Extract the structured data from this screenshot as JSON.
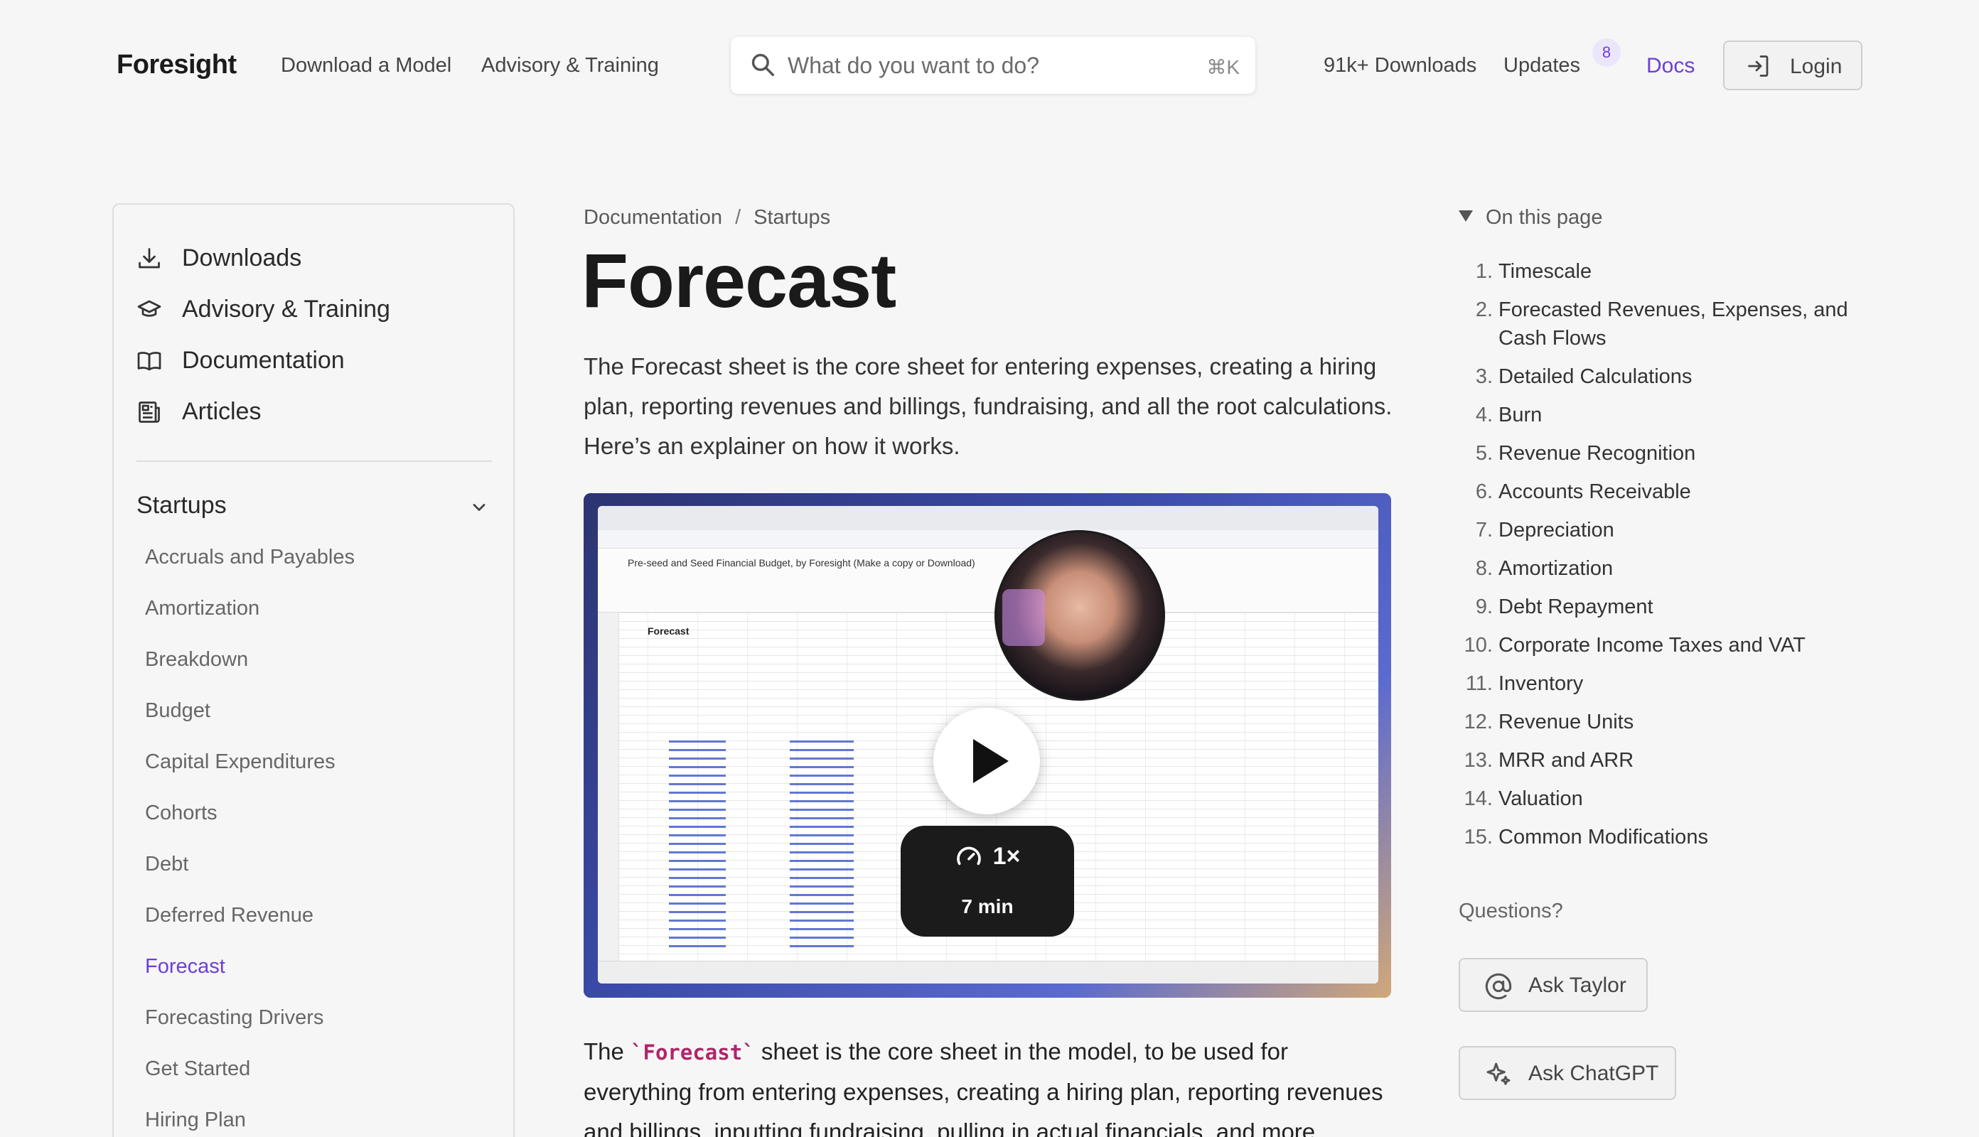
{
  "header": {
    "brand": "Foresight",
    "nav": [
      "Download a Model",
      "Advisory & Training"
    ],
    "search_placeholder": "What do you want to do?",
    "search_shortcut": "⌘K",
    "downloads": "91k+ Downloads",
    "updates": "Updates",
    "updates_badge": "8",
    "docs": "Docs",
    "login": "Login",
    "accent_color": "#6d3fd6"
  },
  "sidebar": {
    "main_items": [
      {
        "label": "Downloads",
        "icon": "download-icon"
      },
      {
        "label": "Advisory & Training",
        "icon": "graduation-cap-icon"
      },
      {
        "label": "Documentation",
        "icon": "book-icon"
      },
      {
        "label": "Articles",
        "icon": "newspaper-icon"
      }
    ],
    "section": "Startups",
    "sub_items": [
      "Accruals and Payables",
      "Amortization",
      "Breakdown",
      "Budget",
      "Capital Expenditures",
      "Cohorts",
      "Debt",
      "Deferred Revenue",
      "Forecast",
      "Forecasting Drivers",
      "Get Started",
      "Hiring Plan"
    ],
    "active_item": "Forecast"
  },
  "main": {
    "breadcrumb": [
      "Documentation",
      "Startups"
    ],
    "breadcrumb_sep": "/",
    "title": "Forecast",
    "intro": "The Forecast sheet is the core sheet for entering expenses, creating a hiring plan, reporting revenues and billings, fundraising, and all the root calculations. Here’s an explainer on how it works.",
    "video": {
      "doc_title": "Pre-seed and Seed Financial Budget, by Foresight (Make a copy or Download)",
      "sheet_title": "Forecast",
      "speed": "1×",
      "duration": "7 min"
    },
    "body_prefix": "The ",
    "body_code": "`Forecast`",
    "body_suffix": " sheet is the core sheet in the model, to be used for everything from entering expenses, creating a hiring plan, reporting revenues and billings, inputting fundraising, pulling in actual financials, and more."
  },
  "toc": {
    "heading": "On this page",
    "items": [
      {
        "num": "1.",
        "label": "Timescale"
      },
      {
        "num": "2.",
        "label": "Forecasted Revenues, Expenses, and Cash Flows"
      },
      {
        "num": "3.",
        "label": "Detailed Calculations"
      },
      {
        "num": "4.",
        "label": "Burn"
      },
      {
        "num": "5.",
        "label": "Revenue Recognition"
      },
      {
        "num": "6.",
        "label": "Accounts Receivable"
      },
      {
        "num": "7.",
        "label": "Depreciation"
      },
      {
        "num": "8.",
        "label": "Amortization"
      },
      {
        "num": "9.",
        "label": "Debt Repayment"
      },
      {
        "num": "10.",
        "label": "Corporate Income Taxes and VAT"
      },
      {
        "num": "11.",
        "label": "Inventory"
      },
      {
        "num": "12.",
        "label": "Revenue Units"
      },
      {
        "num": "13.",
        "label": "MRR and ARR"
      },
      {
        "num": "14.",
        "label": "Valuation"
      },
      {
        "num": "15.",
        "label": "Common Modifications"
      }
    ],
    "questions": "Questions?",
    "ask_taylor": "Ask Taylor",
    "ask_chatgpt": "Ask ChatGPT"
  }
}
